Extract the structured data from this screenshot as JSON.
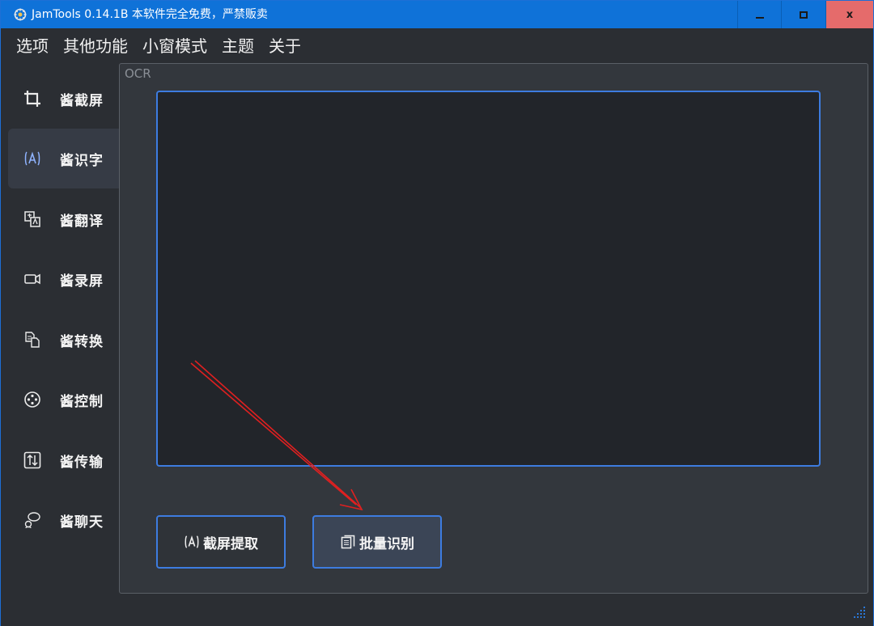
{
  "window": {
    "title": "JamTools 0.14.1B 本软件完全免费，严禁贩卖",
    "accent_color": "#0f72d8",
    "controls": {
      "minimize": "minimize",
      "maximize": "maximize",
      "close": "x"
    }
  },
  "menubar": {
    "items": [
      "选项",
      "其他功能",
      "小窗模式",
      "主题",
      "关于"
    ]
  },
  "sidebar": {
    "active_index": 1,
    "items": [
      {
        "label": "酱截屏",
        "icon": "crop-icon"
      },
      {
        "label": "酱识字",
        "icon": "text-recognition-icon"
      },
      {
        "label": "酱翻译",
        "icon": "translate-icon"
      },
      {
        "label": "酱录屏",
        "icon": "video-camera-icon"
      },
      {
        "label": "酱转换",
        "icon": "file-convert-icon"
      },
      {
        "label": "酱控制",
        "icon": "remote-control-icon"
      },
      {
        "label": "酱传输",
        "icon": "transfer-icon"
      },
      {
        "label": "酱聊天",
        "icon": "chat-icon"
      }
    ]
  },
  "main": {
    "section_label": "OCR",
    "ocr_text": "",
    "buttons": {
      "screenshot_extract": "截屏提取",
      "batch_recognize": "批量识别"
    }
  },
  "annotation": {
    "arrow_color": "#e02020"
  }
}
